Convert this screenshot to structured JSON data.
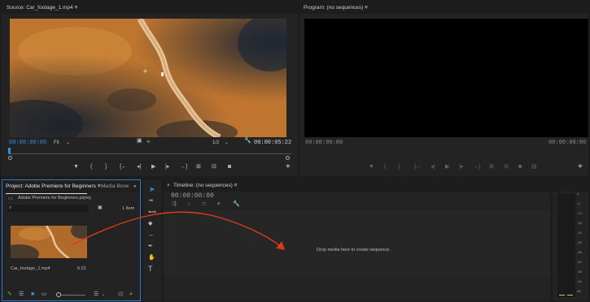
{
  "source": {
    "tab_title": "Source: Car_footage_1.mp4",
    "tab_menu": "≡",
    "timecode_in": "00:00:00:00",
    "fit": "Fit",
    "dropdown_caret": "⌄",
    "resolution": "1/2",
    "timecode_out": "00:00:05:22"
  },
  "program": {
    "tab_title": "Program: (no sequences)",
    "tab_menu": "≡",
    "timecode_left": "00:00:00:00",
    "timecode_right": "00:00:00:00"
  },
  "project": {
    "tab_title": "Project: Adobe Premiere for Beginners",
    "tab_menu": "≡",
    "media_browser_tab": "Media Brow",
    "more": "»",
    "file_name": "Adobe Premiere for Beginners.prproj",
    "item_count": "1 Item",
    "clip_name": "Car_footage_1.mp4",
    "clip_duration": "5:22"
  },
  "timeline": {
    "close": "×",
    "tab_title": "Timeline: (no sequences)",
    "tab_menu": "≡",
    "timecode": "00:00:00:00",
    "drop_text": "Drop media here to create sequence."
  },
  "meter": {
    "labels": [
      "0",
      "-6",
      "-12",
      "-18",
      "-24",
      "-30",
      "-36",
      "-42",
      "-48",
      "-54",
      "dB"
    ]
  },
  "icons": {
    "add": "+",
    "type": "T"
  },
  "colors": {
    "accent_blue": "#2f8ee7",
    "arrow_red": "#e0381f",
    "panel_bg": "#232323",
    "app_bg": "#1d1d1d",
    "project_tab_highlight": "#2b7bd6"
  }
}
